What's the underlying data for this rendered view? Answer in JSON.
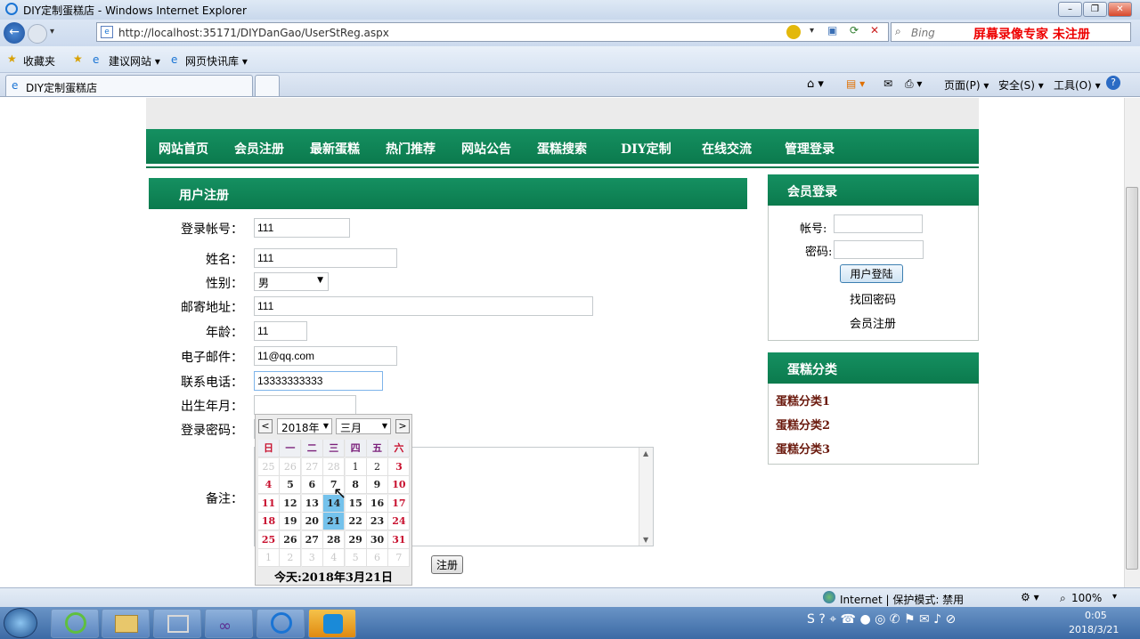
{
  "window": {
    "title": "DIY定制蛋糕店 - Windows Internet Explorer"
  },
  "address": {
    "url": "http://localhost:35171/DIYDanGao/UserStReg.aspx",
    "search_placeholder": "Bing",
    "watermark": "屏幕录像专家 未注册"
  },
  "favorites": {
    "label": "收藏夹",
    "items": [
      "建议网站 ▾",
      "网页快讯库 ▾"
    ]
  },
  "tab": {
    "title": "DIY定制蛋糕店"
  },
  "toolbar": {
    "page": "页面(P) ▾",
    "safety": "安全(S) ▾",
    "tools": "工具(O) ▾"
  },
  "nav": [
    "网站首页",
    "会员注册",
    "最新蛋糕",
    "热门推荐",
    "网站公告",
    "蛋糕搜索",
    "DIY定制",
    "在线交流",
    "管理登录"
  ],
  "register": {
    "title": "用户注册",
    "fields": {
      "account": {
        "label": "登录帐号：",
        "value": "111"
      },
      "name": {
        "label": "姓名：",
        "value": "111"
      },
      "gender": {
        "label": "性别：",
        "value": "男"
      },
      "address": {
        "label": "邮寄地址：",
        "value": "111"
      },
      "age": {
        "label": "年龄：",
        "value": "11"
      },
      "email": {
        "label": "电子邮件：",
        "value": "11@qq.com"
      },
      "phone": {
        "label": "联系电话：",
        "value": "13333333333"
      },
      "birth": {
        "label": "出生年月：",
        "value": ""
      },
      "password": {
        "label": "登录密码：",
        "value": ""
      },
      "remark": {
        "label": "备注：",
        "value": ""
      }
    },
    "submit": "注册"
  },
  "calendar": {
    "year": "2018年",
    "month": "三月",
    "prev": "<",
    "next": ">",
    "weekdays": [
      "日",
      "一",
      "二",
      "三",
      "四",
      "五",
      "六"
    ],
    "rows": [
      [
        "25",
        "26",
        "27",
        "28",
        "1",
        "2",
        "3"
      ],
      [
        "4",
        "5",
        "6",
        "7",
        "8",
        "9",
        "10"
      ],
      [
        "11",
        "12",
        "13",
        "14",
        "15",
        "16",
        "17"
      ],
      [
        "18",
        "19",
        "20",
        "21",
        "22",
        "23",
        "24"
      ],
      [
        "25",
        "26",
        "27",
        "28",
        "29",
        "30",
        "31"
      ],
      [
        "1",
        "2",
        "3",
        "4",
        "5",
        "6",
        "7"
      ]
    ],
    "today": "今天:2018年3月21日"
  },
  "login": {
    "title": "会员登录",
    "account_label": "帐号:",
    "password_label": "密码:",
    "button": "用户登陆",
    "forgot": "找回密码",
    "register": "会员注册"
  },
  "categories": {
    "title": "蛋糕分类",
    "items": [
      "蛋糕分类1",
      "蛋糕分类2",
      "蛋糕分类3"
    ]
  },
  "statusbar": {
    "zone": "Internet | 保护模式: 禁用",
    "zoom": "100%"
  },
  "clock": {
    "time": "0:05",
    "date": "2018/3/21"
  },
  "colors": {
    "green": "#0b7a4d",
    "calendar_highlight": "#74c2ec",
    "red_day": "#c8102e",
    "category_text": "#6b1a0e"
  }
}
